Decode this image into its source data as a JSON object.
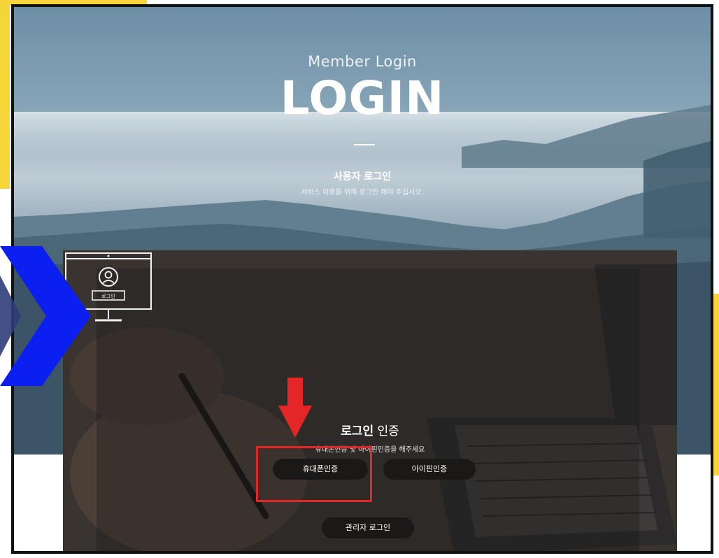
{
  "hero": {
    "subtitle": "Member Login",
    "title": "LOGIN",
    "heading": "사용자 로그인",
    "description": "서비스 이용을 위해 로그인 해야 주십시오."
  },
  "auth": {
    "title_bold": "로그인",
    "title_rest": " 인증",
    "description": "휴대폰인증 및 아이핀인증을 해주세요",
    "monitor_badge": "로그인",
    "buttons": {
      "phone": "휴대폰인증",
      "ipin": "아이핀인증",
      "admin": "관리자 로그인"
    }
  },
  "annotations": {
    "highlight_color": "#e52626",
    "arrow_color": "#e52626",
    "chevron_color": "#0a1ff0",
    "corner_color": "#f7d53a"
  },
  "icons": {
    "monitor": "monitor-user-icon",
    "arrow": "arrow-down-icon",
    "chevron": "chevron-right-icon"
  }
}
